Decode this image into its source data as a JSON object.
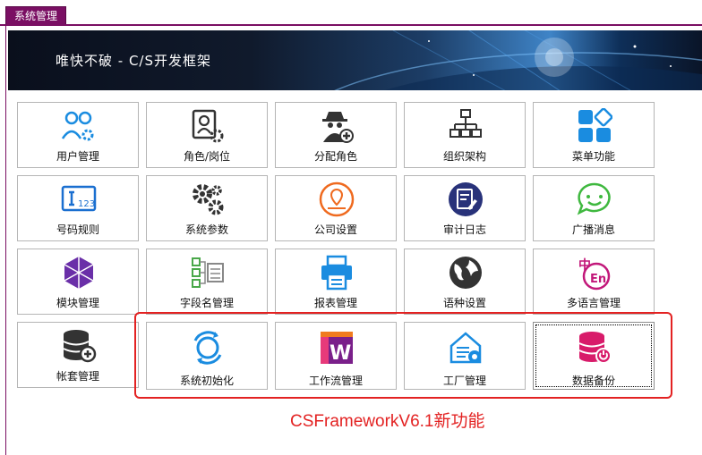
{
  "tab": {
    "label": "系统管理"
  },
  "banner": {
    "title": "唯快不破 - C/S开发框架"
  },
  "tiles": [
    {
      "label": "用户管理",
      "icon": "users-gear-icon",
      "color": "#1a8ce0"
    },
    {
      "label": "角色/岗位",
      "icon": "role-badge-icon",
      "color": "#333333"
    },
    {
      "label": "分配角色",
      "icon": "spy-add-icon",
      "color": "#333333"
    },
    {
      "label": "组织架构",
      "icon": "org-chart-icon",
      "color": "#333333"
    },
    {
      "label": "菜单功能",
      "icon": "menu-blocks-icon",
      "color": "#1a8ce0"
    },
    {
      "label": "号码规则",
      "icon": "number-rule-icon",
      "color": "#1a6fd0"
    },
    {
      "label": "系统参数",
      "icon": "gears-icon",
      "color": "#333333"
    },
    {
      "label": "公司设置",
      "icon": "company-location-icon",
      "color": "#ef6a1f"
    },
    {
      "label": "审计日志",
      "icon": "audit-log-icon",
      "color": "#28327a"
    },
    {
      "label": "广播消息",
      "icon": "chat-bubble-icon",
      "color": "#3fb83f"
    },
    {
      "label": "模块管理",
      "icon": "modules-cube-icon",
      "color": "#6a2fa8"
    },
    {
      "label": "字段名管理",
      "icon": "field-tree-icon",
      "color": "#4aa84a"
    },
    {
      "label": "报表管理",
      "icon": "printer-icon",
      "color": "#1a8ce0"
    },
    {
      "label": "语种设置",
      "icon": "globe-icon",
      "color": "#333333"
    },
    {
      "label": "多语言管理",
      "icon": "zh-en-icon",
      "color": "#c2187a"
    },
    {
      "label": "帐套管理",
      "icon": "database-add-icon",
      "color": "#333333"
    },
    {
      "label": "系统初始化",
      "icon": "refresh-circle-icon",
      "color": "#1a8ce0"
    },
    {
      "label": "工作流管理",
      "icon": "workflow-w-icon",
      "color": "#7a1f8a"
    },
    {
      "label": "工厂管理",
      "icon": "factory-home-icon",
      "color": "#1a8ce0"
    },
    {
      "label": "数据备份",
      "icon": "database-backup-icon",
      "color": "#d81b6a"
    }
  ],
  "note": {
    "text": "CSFrameworkV6.1新功能"
  }
}
